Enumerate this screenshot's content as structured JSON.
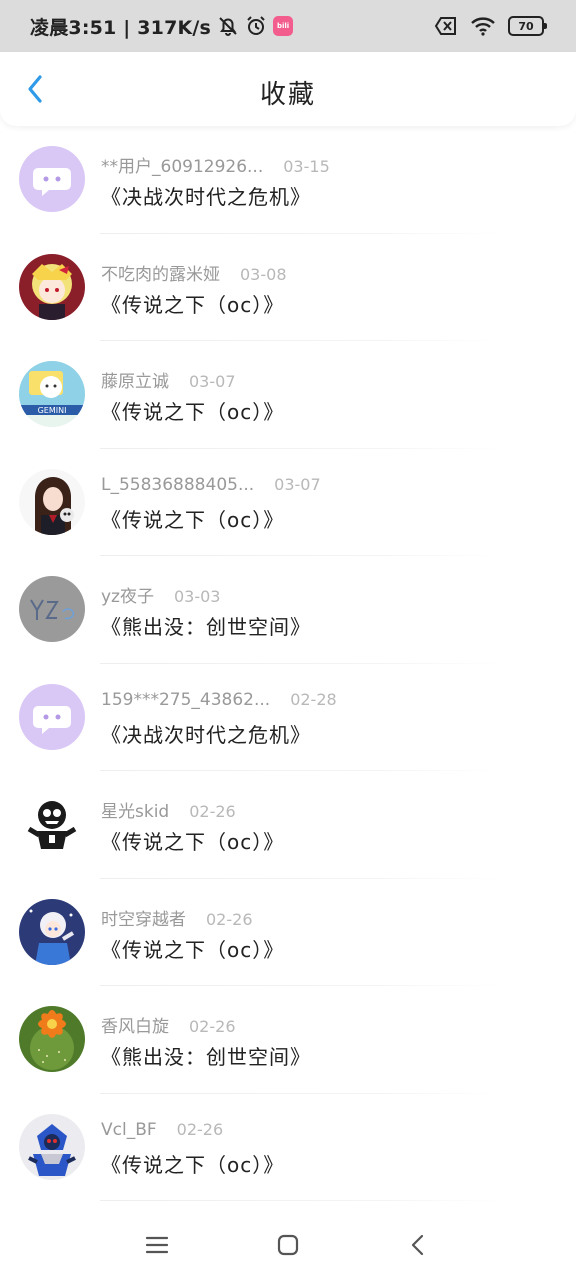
{
  "status_bar": {
    "time_text": "凌晨3:51 | 317K/s",
    "app_badge": "bili",
    "battery": "70",
    "icons": [
      "mute-bell-icon",
      "alarm-icon",
      "bilibili-app-icon",
      "sim-x-icon",
      "wifi-icon",
      "battery-icon"
    ]
  },
  "header": {
    "title": "收藏",
    "back_icon": "chevron-left-icon"
  },
  "items": [
    {
      "username": "**用户_60912926...",
      "date": "03-15",
      "title": "《决战次时代之危机》"
    },
    {
      "username": "不吃肉的露米娅",
      "date": "03-08",
      "title": "《传说之下（oc）》"
    },
    {
      "username": "藤原立诚",
      "date": "03-07",
      "title": "《传说之下（oc）》"
    },
    {
      "username": "L_55836888405...",
      "date": "03-07",
      "title": "《传说之下（oc）》"
    },
    {
      "username": "yz夜子",
      "date": "03-03",
      "title": "《熊出没：创世空间》"
    },
    {
      "username": "159***275_43862...",
      "date": "02-28",
      "title": "《决战次时代之危机》"
    },
    {
      "username": "星光skid",
      "date": "02-26",
      "title": "《传说之下（oc）》"
    },
    {
      "username": "时空穿越者",
      "date": "02-26",
      "title": "《传说之下（oc）》"
    },
    {
      "username": "香风白旋",
      "date": "02-26",
      "title": "《熊出没：创世空间》"
    },
    {
      "username": "Vcl_BF",
      "date": "02-26",
      "title": "《传说之下（oc）》"
    }
  ],
  "nav_bar": {
    "icons": [
      "menu-icon",
      "home-square-icon",
      "back-triangle-icon"
    ]
  },
  "colors": {
    "accent": "#2f9be8",
    "status_bg": "#dcdcdc",
    "default_avatar": "#d9c8f5",
    "username_text": "#999999"
  }
}
